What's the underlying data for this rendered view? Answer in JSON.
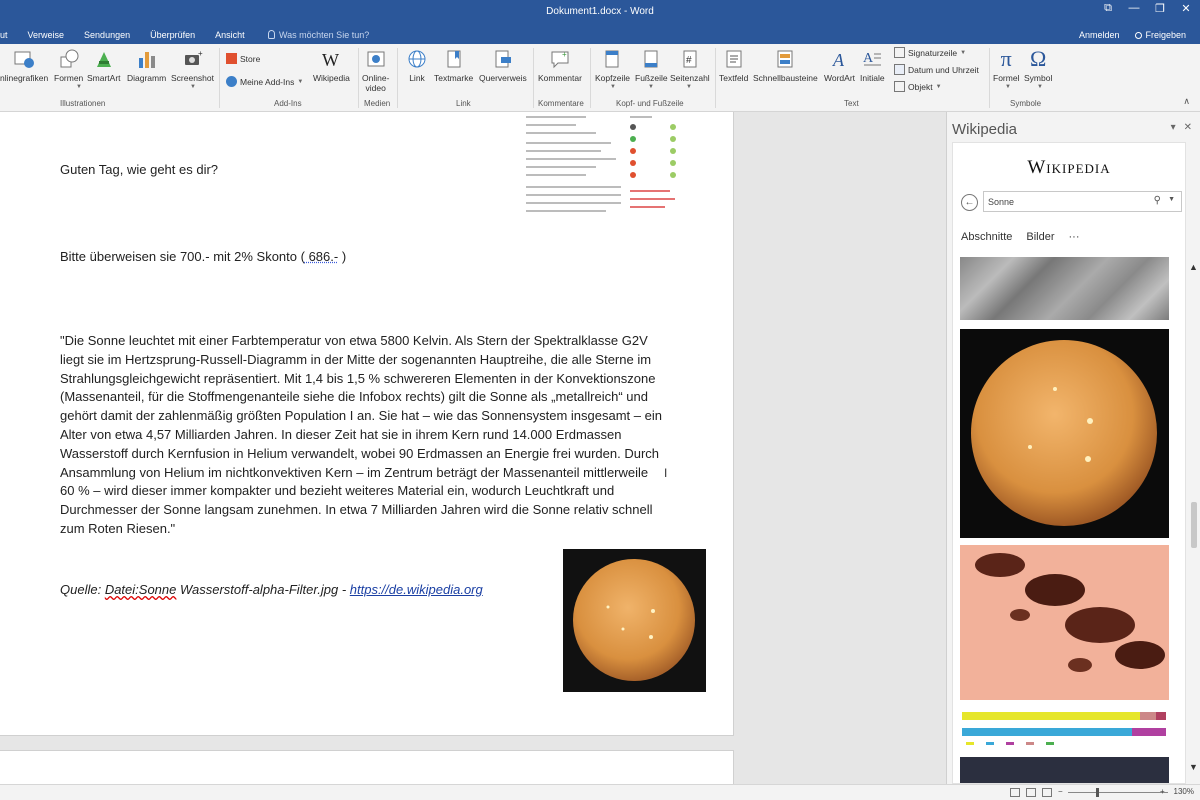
{
  "window": {
    "title": "Dokument1.docx - Word",
    "controls": [
      "⧉",
      "—",
      "❐",
      "✕"
    ]
  },
  "tabs": [
    "ut",
    "Verweise",
    "Sendungen",
    "Überprüfen",
    "Ansicht"
  ],
  "tell_me": "Was möchten Sie tun?",
  "account": {
    "signin": "Anmelden",
    "share": "Freigeben"
  },
  "ribbon": {
    "illustrationen": {
      "label": "Illustrationen",
      "online_grafiken": "nlinegrafiken",
      "formen": "Formen",
      "smartart": "SmartArt",
      "diagramm": "Diagramm",
      "screenshot": "Screenshot"
    },
    "addins": {
      "label": "Add-Ins",
      "store": "Store",
      "meine_addins": "Meine Add-Ins",
      "wikipedia": "Wikipedia"
    },
    "medien": {
      "label": "Medien",
      "online_video_l1": "Online-",
      "online_video_l2": "video"
    },
    "link": {
      "label": "Link",
      "link": "Link",
      "textmarke": "Textmarke",
      "querverweis": "Querverweis"
    },
    "kommentare": {
      "label": "Kommentare",
      "kommentar": "Kommentar"
    },
    "kopf": {
      "label": "Kopf- und Fußzeile",
      "kopfzeile": "Kopfzeile",
      "fusszeile": "Fußzeile",
      "seitenzahl": "Seitenzahl"
    },
    "text": {
      "label": "Text",
      "textfeld": "Textfeld",
      "schnellbausteine": "Schnellbausteine",
      "wordart": "WordArt",
      "initiale": "Initiale",
      "signaturzeile": "Signaturzeile",
      "datum": "Datum und Uhrzeit",
      "objekt": "Objekt"
    },
    "symbole": {
      "label": "Symbole",
      "formel": "Formel",
      "symbol": "Symbol",
      "formel_glyph": "π",
      "symbol_glyph": "Ω"
    }
  },
  "document": {
    "greeting": "Guten Tag, wie geht es dir?",
    "payment_prefix": "Bitte überweisen sie 700.- mit 2% Skonto (",
    "payment_amount": " 686.-",
    "payment_suffix": " )",
    "quote": "\"Die Sonne leuchtet mit einer Farbtemperatur von etwa 5800 Kelvin. Als Stern der Spektralklasse G2V liegt sie im Hertzsprung-Russell-Diagramm in der Mitte der sogenannten Hauptreihe, die alle Sterne im Strahlungsgleichgewicht repräsentiert. Mit 1,4 bis 1,5 % schwereren Elementen in der Konvektionszone (Massenanteil, für die Stoffmengenanteile siehe die Infobox rechts) gilt die Sonne als „metallreich“ und gehört damit der zahlenmäßig größten Population I an. Sie hat – wie das Sonnensystem insgesamt – ein Alter von etwa 4,57 Milliarden Jahren. In dieser Zeit hat sie in ihrem Kern rund 14.000 Erdmassen Wasserstoff durch Kernfusion in Helium verwandelt, wobei 90 Erdmassen an Energie frei wurden. Durch Ansammlung von Helium im nichtkonvektiven Kern – im Zentrum beträgt der Massenanteil mittlerweile 60 % – wird dieser immer kompakter und bezieht weiteres Material ein, wodurch Leuchtkraft und Durchmesser der Sonne langsam zunehmen. In etwa 7 Milliarden Jahren wird die Sonne relativ schnell zum Roten Riesen.\"",
    "source_prefix": "Quelle: ",
    "source_file_a": "Datei:Sonne",
    "source_file_b": " Wasserstoff-alpha-Filter.jpg - ",
    "source_link": "https://de.wikipedia.org"
  },
  "wikipedia_pane": {
    "title": "Wikipedia",
    "logo": "Wikipedia",
    "search_value": "Sonne",
    "tabs": [
      "Abschnitte",
      "Bilder",
      "···"
    ]
  },
  "statusbar": {
    "zoom": "130%"
  },
  "colors": {
    "accent": "#2b579a",
    "ribbon_bg": "#f3f3f3",
    "sun": "#d9903f",
    "link": "#1a3fa3"
  }
}
